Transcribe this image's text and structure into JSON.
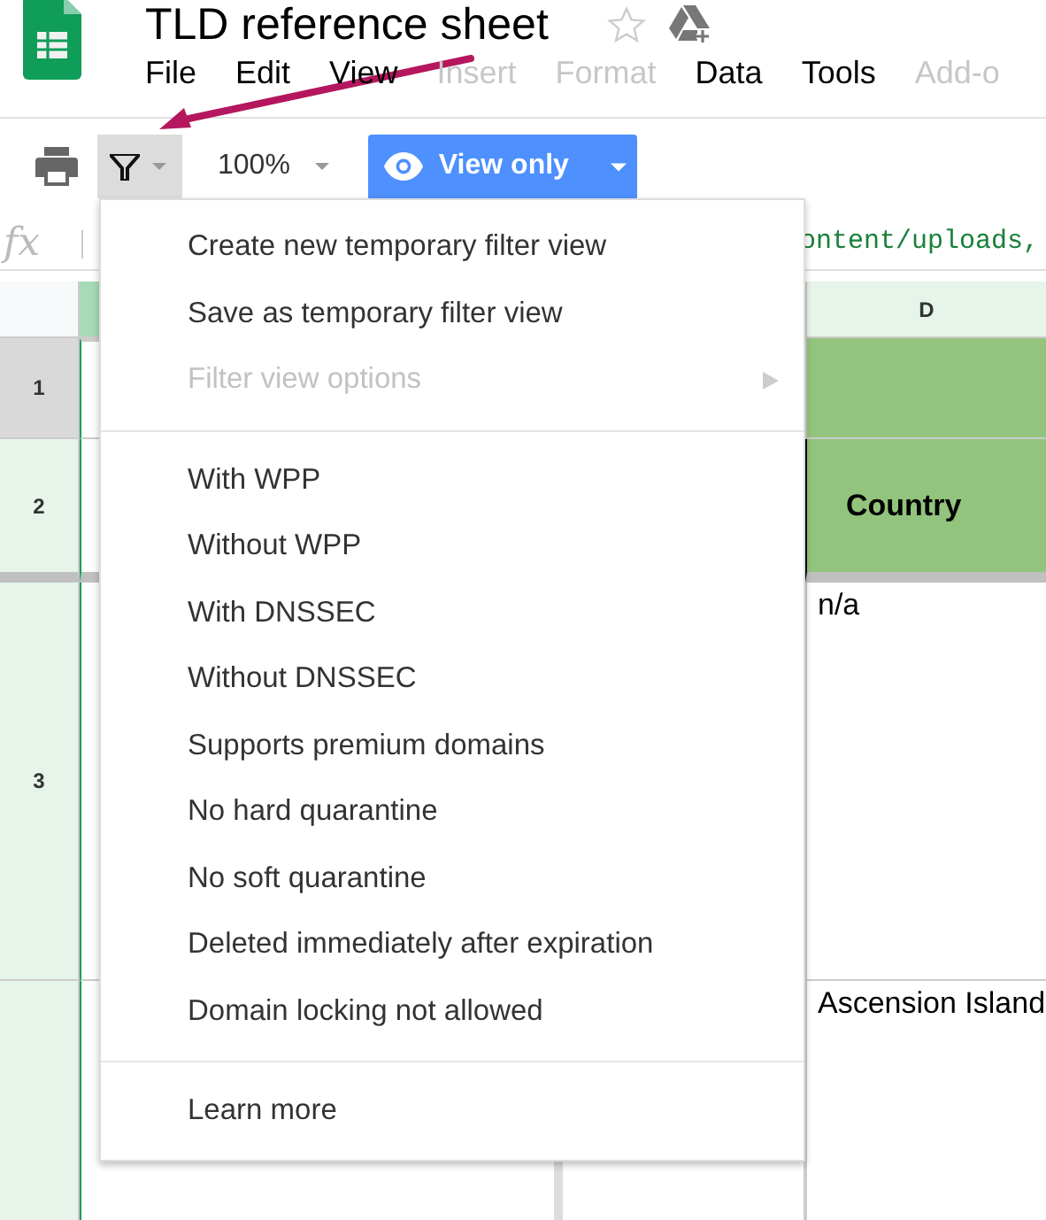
{
  "app": {
    "title": "TLD reference sheet",
    "menus": [
      {
        "label": "File",
        "disabled": false
      },
      {
        "label": "Edit",
        "disabled": false
      },
      {
        "label": "View",
        "disabled": false
      },
      {
        "label": "Insert",
        "disabled": true
      },
      {
        "label": "Format",
        "disabled": true
      },
      {
        "label": "Data",
        "disabled": false
      },
      {
        "label": "Tools",
        "disabled": false
      },
      {
        "label": "Add-o",
        "disabled": true
      }
    ]
  },
  "toolbar": {
    "filter_active": true,
    "zoom": "100%",
    "view_button": "View only"
  },
  "formula_bar": {
    "label": "fx",
    "value": "ontent/uploads,"
  },
  "sheet": {
    "column_d": "D",
    "rows": [
      {
        "number": "1",
        "selected": true,
        "kind": "title"
      },
      {
        "number": "2",
        "selected": false,
        "kind": "header",
        "cell_d": "Country"
      },
      {
        "number": "3",
        "selected": false,
        "kind": "data",
        "cell_d": "n/a"
      },
      {
        "selected": false,
        "kind": "data",
        "cell_d": "Ascension Island"
      }
    ]
  },
  "filter_menu": {
    "sections": [
      [
        {
          "label": "Create new temporary filter view",
          "disabled": false,
          "submenu": false
        },
        {
          "label": "Save as temporary filter view",
          "disabled": false,
          "submenu": false
        },
        {
          "label": "Filter view options",
          "disabled": true,
          "submenu": true
        }
      ],
      [
        {
          "label": "With WPP",
          "disabled": false,
          "submenu": false
        },
        {
          "label": "Without WPP",
          "disabled": false,
          "submenu": false
        },
        {
          "label": "With DNSSEC",
          "disabled": false,
          "submenu": false
        },
        {
          "label": "Without DNSSEC",
          "disabled": false,
          "submenu": false
        },
        {
          "label": "Supports premium domains",
          "disabled": false,
          "submenu": false
        },
        {
          "label": "No hard quarantine",
          "disabled": false,
          "submenu": false
        },
        {
          "label": "No soft quarantine",
          "disabled": false,
          "submenu": false
        },
        {
          "label": "Deleted immediately after expiration",
          "disabled": false,
          "submenu": false
        },
        {
          "label": "Domain locking not allowed",
          "disabled": false,
          "submenu": false
        }
      ],
      [
        {
          "label": "Learn more",
          "disabled": false,
          "submenu": false
        }
      ]
    ]
  }
}
